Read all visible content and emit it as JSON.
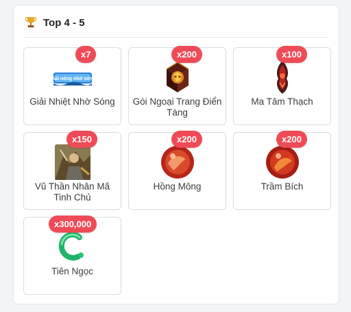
{
  "section": {
    "title": "Top 4 - 5"
  },
  "colors": {
    "badge": "#ef4b57",
    "border": "#d9dbe0"
  },
  "items": [
    {
      "name": "Giải Nhiệt Nhờ Sóng",
      "qty": "x7",
      "icon": "banner-icon",
      "banner_text": "Giải nóng nhờ sóng"
    },
    {
      "name": "Gói Ngoại Trang Điển Tàng",
      "qty": "x200",
      "icon": "chest-icon"
    },
    {
      "name": "Ma Tâm Thạch",
      "qty": "x100",
      "icon": "demon-stone-icon"
    },
    {
      "name": "Vũ Thần Nhân Mã Tinh Chủ",
      "qty": "x150",
      "icon": "warrior-portrait-icon"
    },
    {
      "name": "Hồng Mông",
      "qty": "x200",
      "icon": "red-orb-icon"
    },
    {
      "name": "Trầm Bích",
      "qty": "x200",
      "icon": "red-orb-icon"
    },
    {
      "name": "Tiên Ngọc",
      "qty": "x300,000",
      "icon": "green-jade-icon"
    }
  ]
}
